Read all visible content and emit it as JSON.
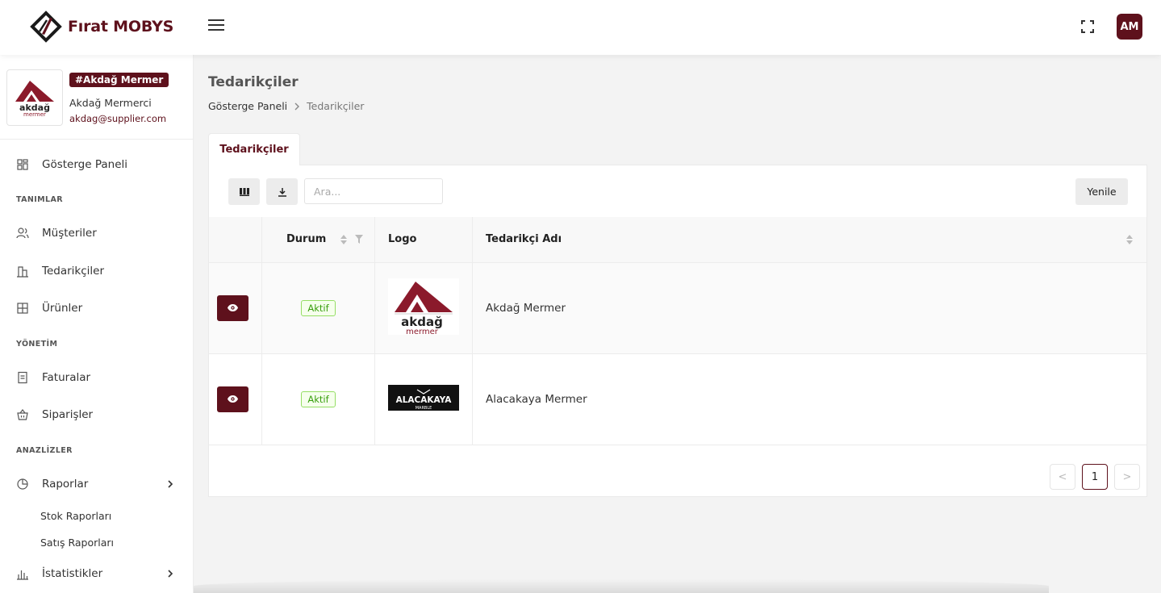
{
  "brand": {
    "name": "Fırat MOBYS"
  },
  "header": {
    "avatar_initials": "AM"
  },
  "profile": {
    "tag": "#Akdağ Mermer",
    "name": "Akdağ Mermerci",
    "email": "akdag@supplier.com",
    "logo_text_top": "akdağ",
    "logo_text_bottom": "mermer"
  },
  "sidebar": {
    "dashboard": "Gösterge Paneli",
    "section_definitions": "TANIMLAR",
    "customers": "Müşteriler",
    "suppliers": "Tedarikçiler",
    "products": "Ürünler",
    "section_management": "YÖNETİM",
    "invoices": "Faturalar",
    "orders": "Siparişler",
    "section_analytics": "ANAZLİZLER",
    "reports": "Raporlar",
    "stock_reports": "Stok Raporları",
    "sales_reports": "Satış Raporları",
    "statistics": "İstatistikler"
  },
  "page": {
    "title": "Tedarikçiler",
    "breadcrumb_home": "Gösterge Paneli",
    "breadcrumb_current": "Tedarikçiler",
    "tab_label": "Tedarikçiler"
  },
  "toolbar": {
    "search_placeholder": "Ara...",
    "refresh_label": "Yenile"
  },
  "table": {
    "columns": {
      "status": "Durum",
      "logo": "Logo",
      "name": "Tedarikçi Adı"
    },
    "rows": [
      {
        "status": "Aktif",
        "name": "Akdağ Mermer",
        "logo_top": "akdağ",
        "logo_bottom": "mermer"
      },
      {
        "status": "Aktif",
        "name": "Alacakaya Mermer",
        "logo_top": "ALACAKAYA",
        "logo_bottom": "MARBLE"
      }
    ]
  },
  "pagination": {
    "current_page": "1",
    "prev": "<",
    "next": ">"
  },
  "colors": {
    "brand": "#5e111c",
    "status_green": "#389e0d"
  }
}
